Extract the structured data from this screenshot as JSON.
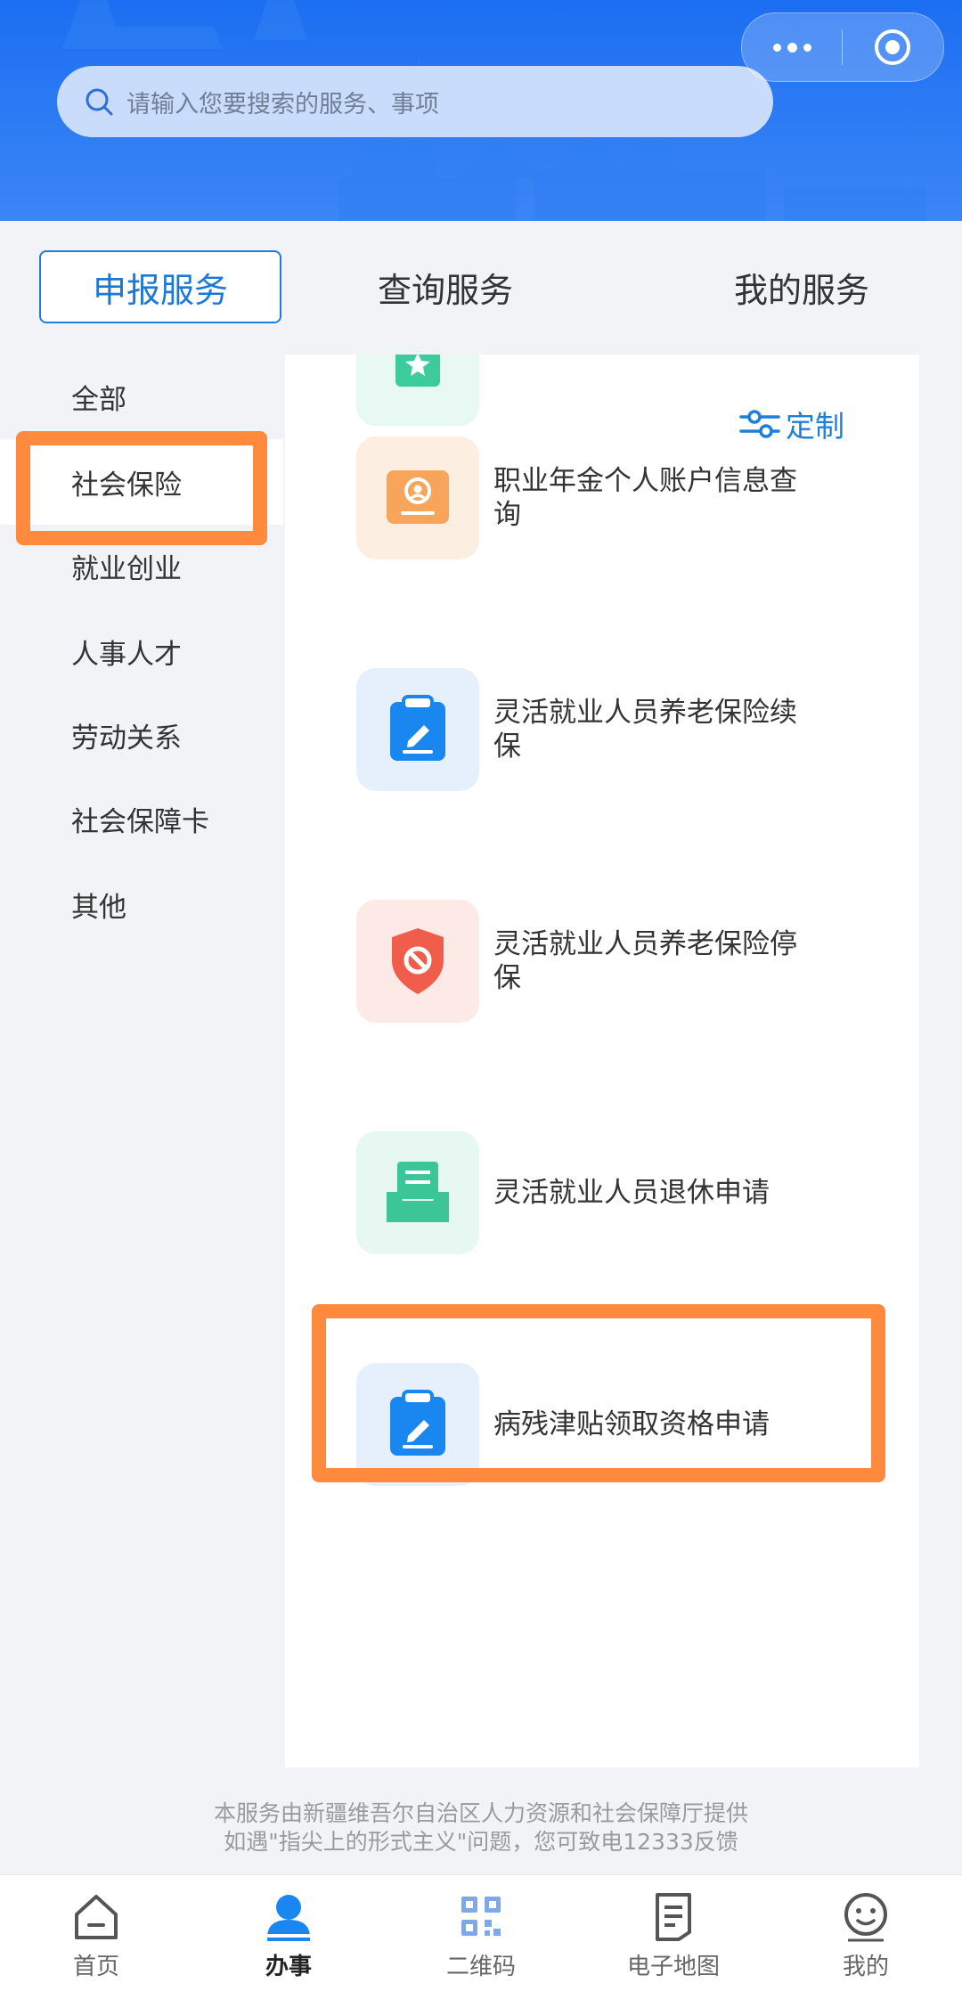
{
  "colors": {
    "brand_blue": "#1c6ef2",
    "accent_orange": "#ff8a3d",
    "link_blue": "#1f7fd8"
  },
  "header": {
    "search_placeholder": "请输入您要搜索的服务、事项"
  },
  "tabs": [
    {
      "label": "申报服务",
      "active": true
    },
    {
      "label": "查询服务",
      "active": false
    },
    {
      "label": "我的服务",
      "active": false
    }
  ],
  "categories": [
    {
      "label": "全部"
    },
    {
      "label": "社会保险",
      "active": true
    },
    {
      "label": "就业创业"
    },
    {
      "label": "人事人才"
    },
    {
      "label": "劳动关系"
    },
    {
      "label": "社会保障卡"
    },
    {
      "label": "其他"
    }
  ],
  "panel": {
    "customize_label": "定制",
    "services": [
      {
        "label": "",
        "icon": "badge-icon"
      },
      {
        "label": "职业年金个人账户信息查询",
        "icon": "id-card-icon"
      },
      {
        "label": "灵活就业人员养老保险续保",
        "icon": "clipboard-edit-icon"
      },
      {
        "label": "灵活就业人员养老保险停保",
        "icon": "shield-ban-icon"
      },
      {
        "label": "灵活就业人员退休申请",
        "icon": "inbox-document-icon"
      },
      {
        "label": "病残津贴领取资格申请",
        "icon": "clipboard-edit-icon"
      }
    ]
  },
  "footer": {
    "line1": "本服务由新疆维吾尔自治区人力资源和社会保障厅提供",
    "line2": "如遇\"指尖上的形式主义\"问题，您可致电12333反馈"
  },
  "tabbar": [
    {
      "label": "首页",
      "icon": "home-icon"
    },
    {
      "label": "办事",
      "icon": "person-icon",
      "active": true
    },
    {
      "label": "二维码",
      "icon": "qr-code-icon"
    },
    {
      "label": "电子地图",
      "icon": "map-document-icon"
    },
    {
      "label": "我的",
      "icon": "smile-face-icon"
    }
  ]
}
